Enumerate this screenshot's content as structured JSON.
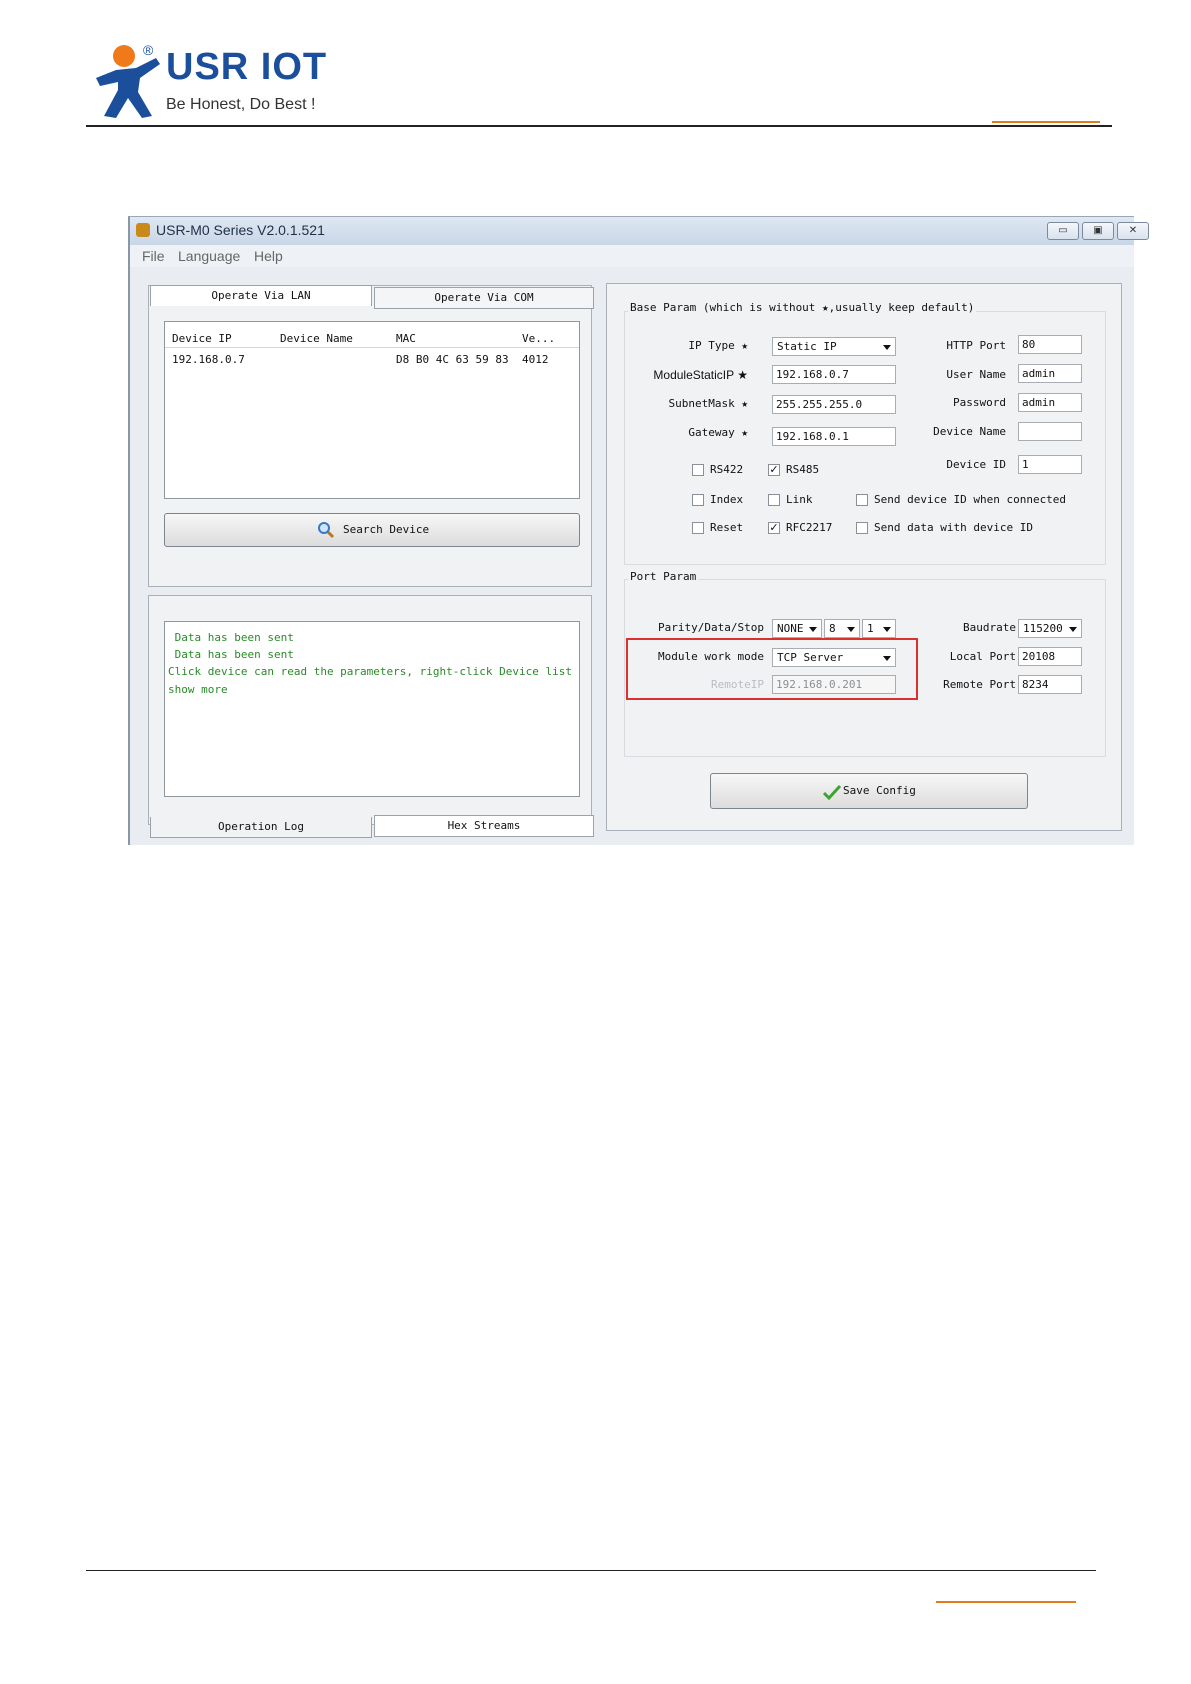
{
  "header": {
    "brand": "USR IOT",
    "registered": "®",
    "tagline": "Be Honest, Do Best !"
  },
  "window": {
    "title": "USR-M0 Series V2.0.1.521",
    "menu": [
      "File",
      "Language",
      "Help"
    ],
    "buttons": {
      "minimize": "▭",
      "maximize": "▣",
      "close": "✕"
    }
  },
  "left": {
    "tabs": {
      "lan": "Operate Via LAN",
      "com": "Operate Via COM"
    },
    "table": {
      "headers": [
        "Device IP",
        "Device Name",
        "MAC",
        "Ve..."
      ],
      "rows": [
        {
          "ip": "192.168.0.7",
          "name": "",
          "mac": "D8 B0 4C 63 59 83",
          "ver": "4012"
        }
      ]
    },
    "search_button": "Search Device",
    "log_lines": [
      " Data has been sent",
      " Data has been sent",
      "Click device can read the parameters, right-click Device list",
      "show more"
    ],
    "bottom_tabs": {
      "log": "Operation Log",
      "hex": "Hex Streams"
    }
  },
  "base": {
    "section_title": "Base Param (which is without ★,usually keep default)",
    "ip_type_label": "IP Type ★",
    "ip_type": "Static IP",
    "static_ip_label": "ModuleStaticIP ★",
    "static_ip": "192.168.0.7",
    "subnet_label": "SubnetMask ★",
    "subnet": "255.255.255.0",
    "gateway_label": "Gateway ★",
    "gateway": "192.168.0.1",
    "http_port_label": "HTTP Port",
    "http_port": "80",
    "user_label": "User Name",
    "user": "admin",
    "password_label": "Password",
    "password": "admin",
    "device_name_label": "Device Name",
    "device_name": "",
    "device_id_label": "Device ID",
    "device_id": "1",
    "checkboxes": {
      "rs422": {
        "label": "RS422",
        "mark": ""
      },
      "rs485": {
        "label": "RS485",
        "mark": "✓"
      },
      "index": {
        "label": "Index",
        "mark": ""
      },
      "link": {
        "label": "Link",
        "mark": ""
      },
      "send_id_conn": {
        "label": "Send device ID when connected",
        "mark": ""
      },
      "reset": {
        "label": "Reset",
        "mark": ""
      },
      "rfc2217": {
        "label": "RFC2217",
        "mark": "✓"
      },
      "send_data_id": {
        "label": "Send data with device ID",
        "mark": ""
      }
    }
  },
  "port": {
    "section_title": "Port Param",
    "pds_label": "Parity/Data/Stop",
    "parity": "NONE",
    "data_bits": "8",
    "stop_bits": "1",
    "baud_label": "Baudrate",
    "baud": "115200",
    "mode_label": "Module work mode",
    "mode": "TCP Server",
    "remote_ip_label": "RemoteIP",
    "remote_ip": "192.168.0.201",
    "local_port_label": "Local Port",
    "local_port": "20108",
    "remote_port_label": "Remote Port",
    "remote_port": "8234",
    "save_button": "Save Config"
  },
  "colors": {
    "brand": "#1b4f9c",
    "logo_orange": "#f07a1a",
    "highlight": "#d93030",
    "log_text": "#2a8a2a"
  }
}
